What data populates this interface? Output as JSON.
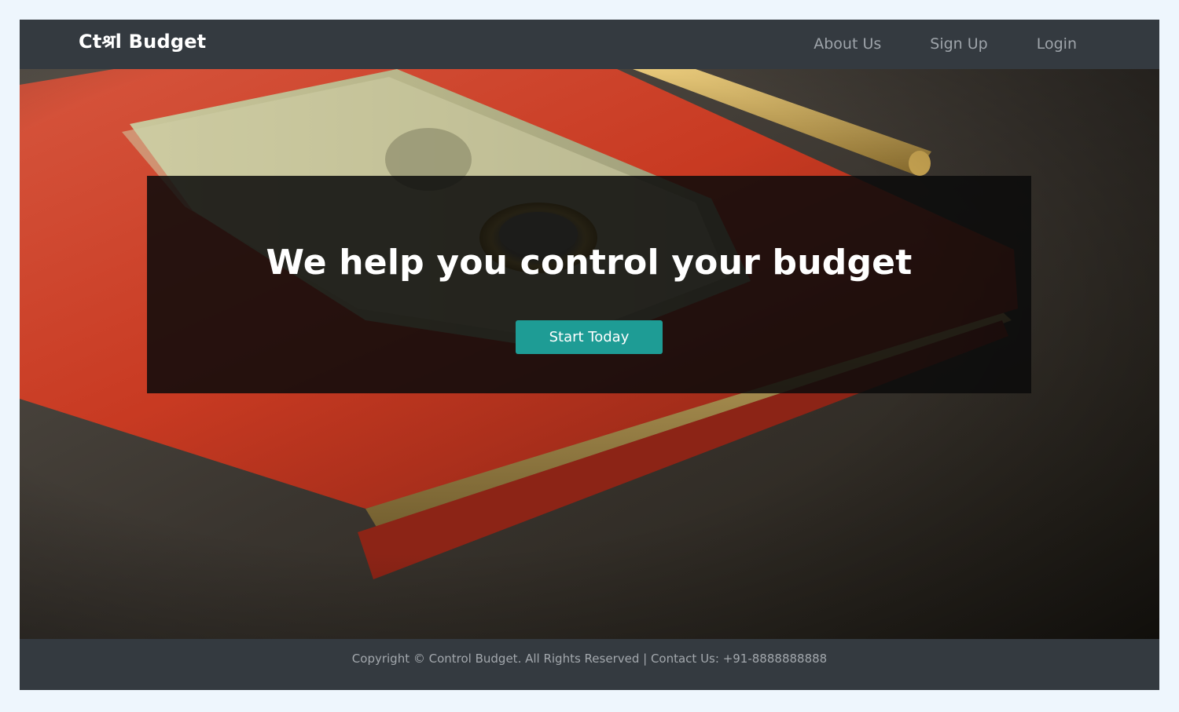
{
  "navbar": {
    "brand": "Ctश्रl Budget",
    "links": [
      {
        "label": "About Us"
      },
      {
        "label": "Sign Up"
      },
      {
        "label": "Login"
      }
    ]
  },
  "hero": {
    "title": "We help you control your budget",
    "cta_label": "Start Today",
    "background_description_icon": "notebook-with-money-image",
    "accent_color": "#1e9c95"
  },
  "footer": {
    "text": "Copyright © Control Budget. All Rights Reserved | Contact Us: +91-8888888888"
  },
  "colors": {
    "page_background": "#eef6fd",
    "navbar_background": "#343a40",
    "nav_link": "#9ea4aa",
    "overlay": "#0a0a0a"
  }
}
